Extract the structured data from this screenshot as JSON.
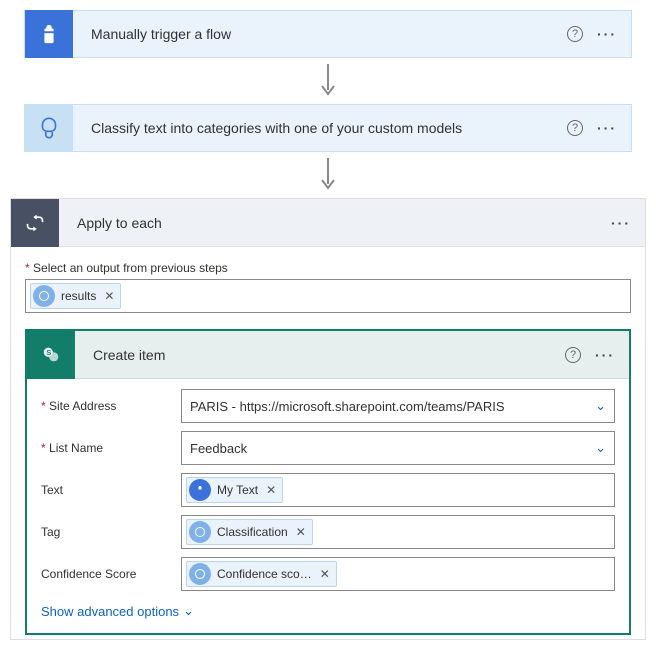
{
  "cards": {
    "trigger": {
      "title": "Manually trigger a flow"
    },
    "classify": {
      "title": "Classify text into categories with one of your custom models"
    },
    "applyEach": {
      "title": "Apply to each"
    },
    "createItem": {
      "title": "Create item"
    }
  },
  "applyEach": {
    "outputLabel": "Select an output from previous steps",
    "pill": {
      "label": "results"
    }
  },
  "createItem": {
    "rows": {
      "siteAddress": {
        "label": "Site Address",
        "value": "PARIS - https://microsoft.sharepoint.com/teams/PARIS"
      },
      "listName": {
        "label": "List Name",
        "value": "Feedback"
      },
      "text": {
        "label": "Text",
        "pill": "My Text"
      },
      "tag": {
        "label": "Tag",
        "pill": "Classification"
      },
      "confidence": {
        "label": "Confidence Score",
        "pill": "Confidence sco…"
      }
    },
    "advanced": "Show advanced options"
  }
}
